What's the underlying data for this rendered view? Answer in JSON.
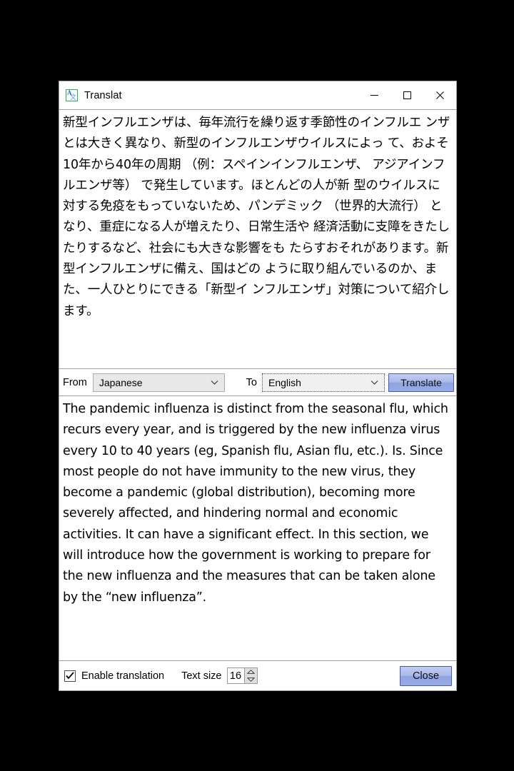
{
  "window": {
    "title": "Translat",
    "icon": "translate-app-icon",
    "icon_letter_latin": "A",
    "icon_letter_japanese": "文",
    "accent_blue": "#9aabe6",
    "icon_border_green": "#22b14c",
    "controls": {
      "minimize": "minimize-icon",
      "maximize": "maximize-icon",
      "close": "close-icon"
    }
  },
  "source": {
    "text": "新型インフルエンザは、毎年流行を繰り返す季節性のインフルエ ンザとは大きく異なり、新型のインフルエンザウイルスによっ て、およそ10年から40年の周期 （例：スペインインフルエンザ、 アジアインフルエンザ等） で発生しています。ほとんどの人が新 型のウイルスに対する免疫をもっていないため、パンデミック （世界的大流行） となり、重症になる人が増えたり、日常生活や 経済活動に支障をきたしたりするなど、社会にも大きな影響をも たらすおそれがあります。新型インフルエンザに備え、国はどの ように取り組んでいるのか、また、一人ひとりにできる「新型イ ンフルエンザ」対策について紹介します。"
  },
  "target": {
    "text": "The pandemic influenza is distinct from the seasonal flu, which recurs every year, and is triggered by the new influenza virus every 10 to 40 years (eg, Spanish flu, Asian flu, etc.). Is. Since most people do not have immunity to the new virus, they become a pandemic (global distribution), becoming more severely affected, and hindering normal and economic activities. It can have a significant effect. In this section, we will introduce how the government is working to prepare for the new influenza and the measures that can be taken alone by the “new influenza”."
  },
  "controls": {
    "from_label": "From",
    "from_value": "Japanese",
    "to_label": "To",
    "to_value": "English",
    "translate_label": "Translate",
    "chevron_icon": "chevron-down-icon"
  },
  "footer": {
    "enable_translation_label": "Enable translation",
    "enable_translation_checked": true,
    "check_icon": "check-icon",
    "text_size_label": "Text size",
    "text_size_value": "16",
    "spinner_up_icon": "spinner-up-icon",
    "spinner_down_icon": "spinner-down-icon",
    "close_label": "Close"
  }
}
